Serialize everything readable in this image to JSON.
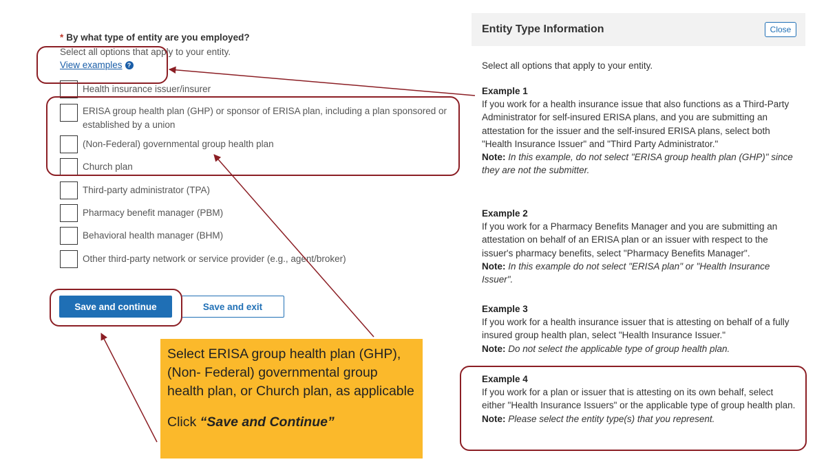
{
  "form": {
    "required_mark": "*",
    "question": "By what type of entity are you employed?",
    "hint": "Select all options that apply to your entity.",
    "view_examples": "View examples",
    "help_glyph": "?",
    "options": [
      "Health insurance issuer/insurer",
      "ERISA group health plan (GHP) or sponsor of ERISA plan, including a plan sponsored or established by a union",
      "(Non-Federal) governmental group health plan",
      "Church plan",
      "Third-party administrator (TPA)",
      "Pharmacy benefit manager (PBM)",
      "Behavioral health manager (BHM)",
      "Other third-party network or service provider (e.g., agent/broker)"
    ],
    "save_continue": "Save and continue",
    "save_exit": "Save and exit"
  },
  "callout": {
    "text": "Select ERISA group health plan (GHP), (Non- Federal) governmental group health plan, or Church plan, as applicable",
    "click_prefix": "Click ",
    "click_target": "“Save and Continue”"
  },
  "panel": {
    "title": "Entity Type Information",
    "close": "Close",
    "intro": "Select all options that apply to your entity.",
    "note_label": "Note:",
    "examples": [
      {
        "title": "Example 1",
        "body": "If you work for a health insurance issue that also functions as a Third-Party Administrator for self-insured ERISA plans, and you are submitting an attestation for the issuer and the self-insured ERISA plans, select both \"Health Insurance Issuer\" and \"Third Party Administrator.\"",
        "note": "In this example, do not select \"ERISA group health plan (GHP)\" since they are not the submitter."
      },
      {
        "title": "Example 2",
        "body": "If you work for a Pharmacy Benefits Manager and you are submitting an attestation on behalf of an ERISA plan or an issuer with respect to the issuer's pharmacy benefits, select \"Pharmacy Benefits Manager\".",
        "note": "In this example do not select \"ERISA plan\" or \"Health Insurance Issuer\"."
      },
      {
        "title": "Example 3",
        "body": "If you work for a health insurance issuer that is attesting on behalf of a fully insured group health plan, select \"Health Insurance Issuer.\"",
        "note": "Do not select the applicable type of group health plan."
      },
      {
        "title": "Example 4",
        "body": "If you work for a plan or issuer that is attesting on its own behalf, select either \"Health Insurance Issuers\" or the applicable type of group health plan.",
        "note": "Please select the entity type(s) that you represent."
      }
    ]
  },
  "colors": {
    "accent_blue": "#1f6fb5",
    "annotation_red": "#8b1e24",
    "callout_yellow": "#fbb92b"
  }
}
